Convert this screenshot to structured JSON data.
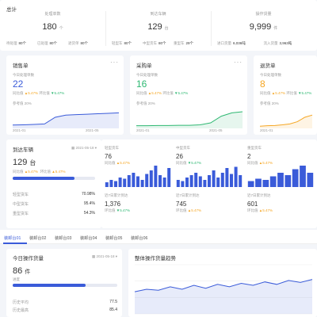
{
  "summary": {
    "title": "总计",
    "cols": [
      {
        "label": "处理单数",
        "value": "180",
        "unit": "个",
        "details": [
          [
            "待处理",
            "80个"
          ],
          [
            "已处理",
            "80个"
          ],
          [
            "退货单",
            "80个"
          ]
        ]
      },
      {
        "label": "到达车辆",
        "value": "129",
        "unit": "台",
        "details": [
          [
            "轻型车",
            "80个"
          ],
          [
            "中型货车",
            "80个"
          ],
          [
            "重型车",
            "29个"
          ]
        ]
      },
      {
        "label": "操作货量",
        "value": "9,999",
        "unit": "件",
        "details": [
          [
            "进口货量",
            "6,036吨"
          ],
          [
            "流入货量",
            "3,963吨"
          ]
        ]
      }
    ]
  },
  "metrics": [
    {
      "title": "销售单",
      "sub": "今日处理单数",
      "value": "22",
      "val_color": "#3a5bd9",
      "chg1": "5.47%",
      "chg2": "5.47%",
      "lbl1": "同比值",
      "lbl2": "环比值",
      "ref": "参考值 20%",
      "x0": "2021-01",
      "x1": "2021-05",
      "color": "#3a5bd9",
      "line": [
        0.15,
        0.16,
        0.18,
        0.2,
        0.5,
        0.6,
        0.62,
        0.64,
        0.66,
        0.68,
        0.7
      ]
    },
    {
      "title": "采购单",
      "sub": "今日处理单数",
      "value": "16",
      "val_color": "#2eb872",
      "chg1": "5.47%",
      "chg2": "5.47%",
      "lbl1": "同比值",
      "lbl2": "环比值",
      "ref": "参考值 20%",
      "x0": "2021-01",
      "x1": "2021-05",
      "color": "#2eb872",
      "line": [
        0.12,
        0.12,
        0.13,
        0.13,
        0.14,
        0.14,
        0.16,
        0.25,
        0.55,
        0.7,
        0.75
      ]
    },
    {
      "title": "退货单",
      "sub": "今日处理单数",
      "value": "8",
      "val_color": "#f5a623",
      "chg1": "5.47%",
      "chg2": "5.47%",
      "lbl1": "同比值",
      "lbl2": "环比值",
      "ref": "参考值 20%",
      "x0": "2021-01",
      "x1": "",
      "color": "#f5a623",
      "line": [
        0.1,
        0.12,
        0.13,
        0.16,
        0.2,
        0.3,
        0.5,
        0.6
      ]
    }
  ],
  "arrival": {
    "title": "到达车辆",
    "date": "2021-05-18",
    "value": "129",
    "unit": "台",
    "chg1": "5.47%",
    "chg2": "5.47%",
    "lbl1": "同比值",
    "lbl2": "环比值",
    "progress": 0.75,
    "rows": [
      [
        "轻型货车",
        "70.98%"
      ],
      [
        "中型货车",
        "95.4%"
      ],
      [
        "重型货车",
        "54.3%"
      ]
    ]
  },
  "vehicles": [
    {
      "label": "轻型货车",
      "value": "76",
      "chg": "5.47%",
      "dir": "up",
      "lbl": "同比值"
    },
    {
      "label": "中型货车",
      "value": "26",
      "chg": "5.47%",
      "dir": "down",
      "lbl": "同比值"
    },
    {
      "label": "重型货车",
      "value": "2",
      "chg": "5.47%",
      "dir": "up",
      "lbl": "同比值"
    }
  ],
  "vehicles2": [
    {
      "label": "近7日累计到达",
      "value": "1,376",
      "chg": "5.47%",
      "dir": "down",
      "lbl": "环比值"
    },
    {
      "label": "近7日累计到达",
      "value": "745",
      "chg": "5.47%",
      "dir": "up",
      "lbl": "环比值"
    },
    {
      "label": "近7日累计到达",
      "value": "601",
      "chg": "5.47%",
      "dir": "up",
      "lbl": "环比值"
    }
  ],
  "bars": [
    [
      0.2,
      0.3,
      0.25,
      0.4,
      0.35,
      0.5,
      0.6,
      0.45,
      0.3,
      0.55,
      0.7,
      0.9,
      0.5,
      0.4,
      0.8
    ],
    [
      0.3,
      0.25,
      0.4,
      0.5,
      0.6,
      0.45,
      0.3,
      0.5,
      0.7,
      0.4,
      0.6,
      0.8,
      0.55,
      0.85,
      0.5
    ],
    [
      0.25,
      0.35,
      0.3,
      0.45,
      0.6,
      0.5,
      0.75,
      0.9,
      0.6
    ]
  ],
  "tabs": [
    "装卸台01",
    "装卸台02",
    "装卸台03",
    "装卸台04",
    "装卸台05",
    "装卸台06"
  ],
  "today": {
    "title": "今日操作货量",
    "date": "2021-05-18",
    "value": "86",
    "unit": "件",
    "progress_label": "进度",
    "progress": 0.7,
    "rows": [
      [
        "历史平均",
        "77.5"
      ],
      [
        "历史最高",
        "85.4"
      ]
    ]
  },
  "trend": {
    "title": "整体操作货量趋势",
    "line": [
      0.45,
      0.5,
      0.48,
      0.55,
      0.5,
      0.58,
      0.52,
      0.6,
      0.55,
      0.62,
      0.58,
      0.65,
      0.6,
      0.68,
      0.64,
      0.7
    ],
    "color": "#3a5bd9"
  }
}
